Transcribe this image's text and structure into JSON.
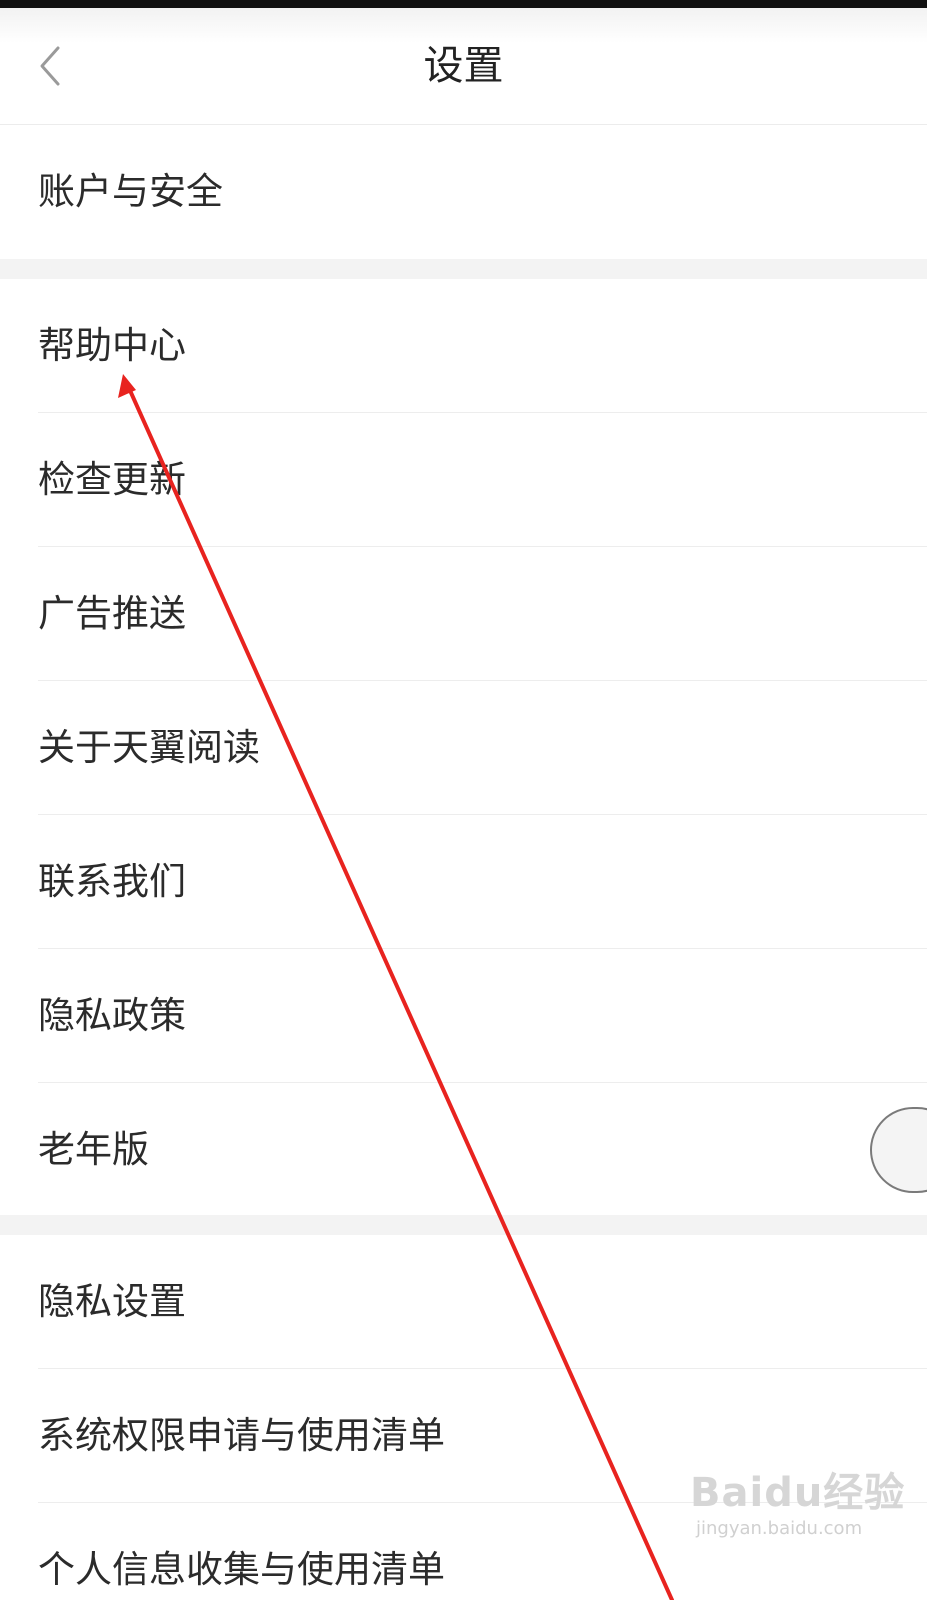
{
  "header": {
    "title": "设置",
    "back_icon": "chevron-left-icon"
  },
  "groups": [
    {
      "items": [
        {
          "label": "账户与安全"
        }
      ]
    },
    {
      "items": [
        {
          "label": "帮助中心"
        },
        {
          "label": "检查更新"
        },
        {
          "label": "广告推送"
        },
        {
          "label": "关于天翼阅读"
        },
        {
          "label": "联系我们"
        },
        {
          "label": "隐私政策"
        },
        {
          "label": "老年版",
          "toggle": "off"
        }
      ]
    },
    {
      "items": [
        {
          "label": "隐私设置"
        },
        {
          "label": "系统权限申请与使用清单"
        },
        {
          "label": "个人信息收集与使用清单"
        }
      ]
    }
  ],
  "watermark": {
    "brand": "Baidu经验",
    "url": "jingyan.baidu.com"
  },
  "colors": {
    "annotation_arrow": "#e8231f",
    "background": "#ffffff",
    "section_gap": "#f3f3f3",
    "text": "#2b2b2b"
  }
}
